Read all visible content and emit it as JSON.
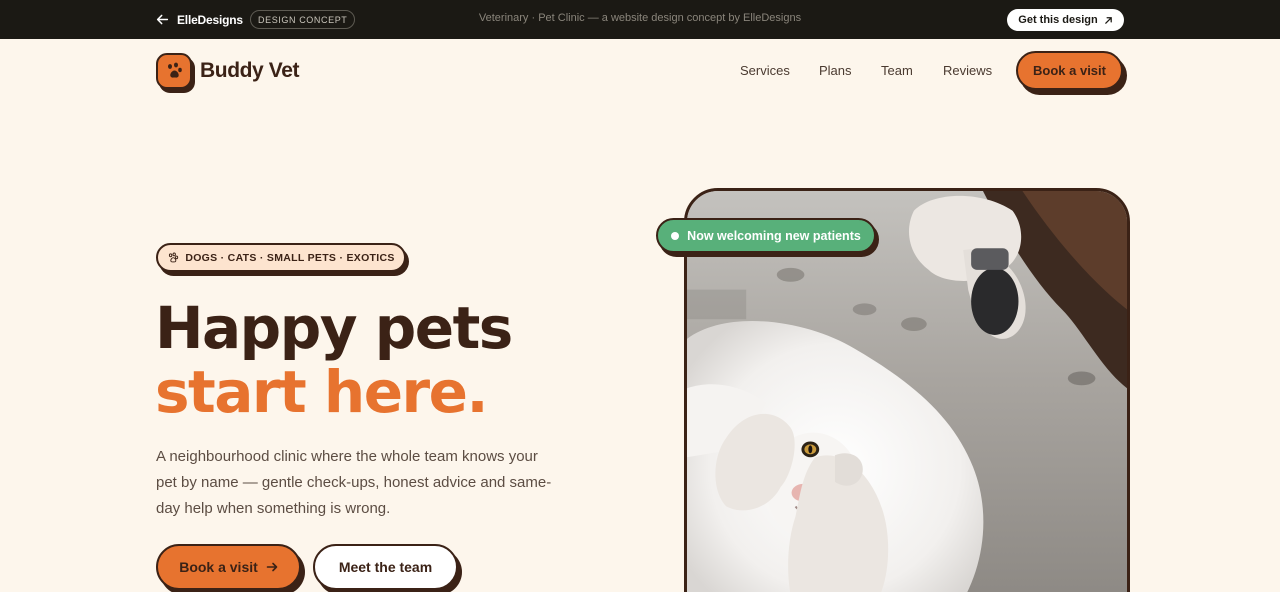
{
  "topbar": {
    "back_label": "ElleDesigns",
    "badge": "DESIGN CONCEPT",
    "caption": "Veterinary · Pet Clinic — a website design concept by ElleDesigns",
    "cta": "Get this design"
  },
  "nav": {
    "logo_text": "Buddy Vet",
    "links": [
      "Services",
      "Plans",
      "Team",
      "Reviews"
    ],
    "cta": "Book a visit"
  },
  "hero": {
    "tag": "DOGS · CATS · SMALL PETS · EXOTICS",
    "title_line1": "Happy pets",
    "title_line2": "start here.",
    "description": "A neighbourhood clinic where the whole team knows your pet by name — gentle check-ups, honest advice and same-day help when something is wrong.",
    "primary_button": "Book a visit",
    "secondary_button": "Meet the team",
    "status_pill": "Now welcoming new patients"
  },
  "colors": {
    "background": "#fdf6ec",
    "accent": "#e7732f",
    "dark": "#3b2216",
    "success": "#58b07a"
  },
  "icons": {
    "back": "arrow-left-icon",
    "external": "arrow-up-right-icon",
    "logo": "paw-icon",
    "tag": "paw-icon",
    "button_arrow": "arrow-right-icon"
  }
}
